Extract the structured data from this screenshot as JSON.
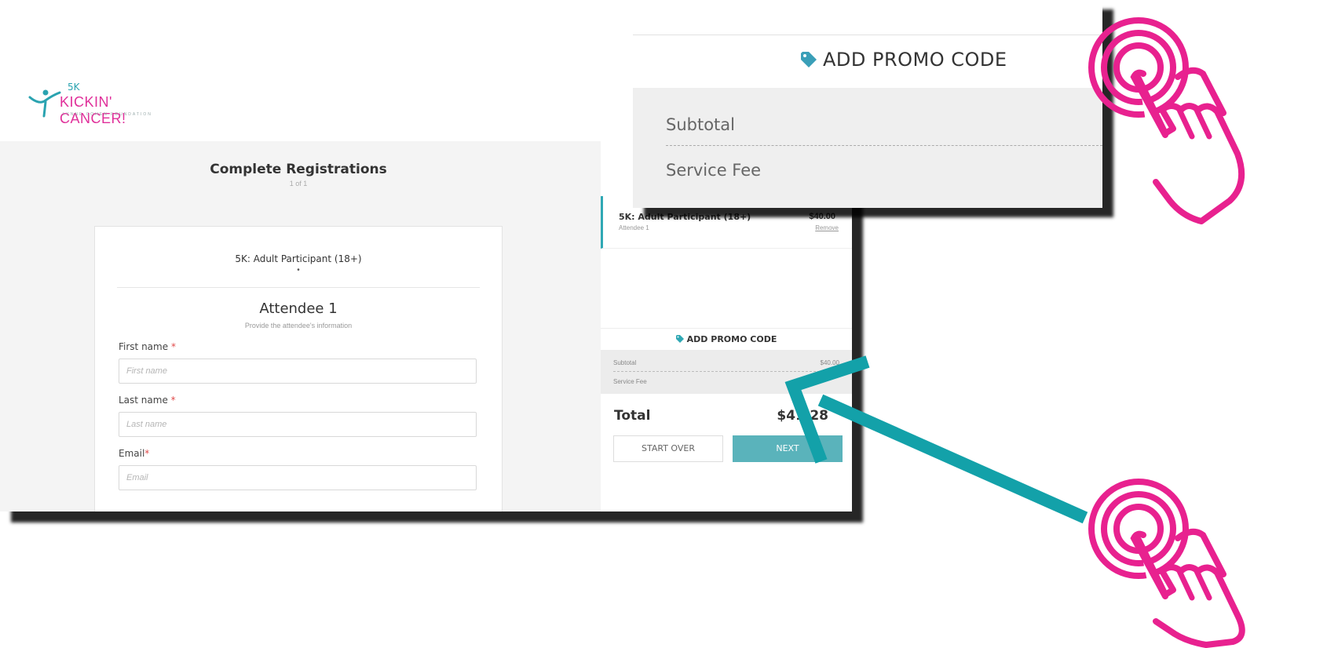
{
  "logo": {
    "five": "5K",
    "brand": "KICKIN' CANCER!",
    "sub": "LYNNE COHEN FOUNDATION"
  },
  "page": {
    "title": "Complete Registrations",
    "subtitle": "1 of 1"
  },
  "form": {
    "ticket_title": "5K: Adult Participant (18+)",
    "ticket_dot": "•",
    "attendee_title": "Attendee 1",
    "attendee_subtitle": "Provide the attendee's information",
    "fields": [
      {
        "label": "First name",
        "required": "*",
        "placeholder": "First name"
      },
      {
        "label": "Last name",
        "required": "*",
        "placeholder": "Last name"
      },
      {
        "label": "Email",
        "required": "*",
        "placeholder": "Email"
      }
    ]
  },
  "summary": {
    "item_title": "5K: Adult Participant (18+)",
    "item_attendee": "Attendee 1",
    "item_price": "$40.00",
    "item_remove": "Remove",
    "promo_label": "ADD PROMO CODE",
    "subtotal_label": "Subtotal",
    "subtotal_amount": "$40.00",
    "service_fee_label": "Service Fee",
    "total_label": "Total",
    "total_amount": "$41.28",
    "start_over_label": "START OVER",
    "next_label": "NEXT"
  },
  "zoom": {
    "promo_label": "ADD PROMO CODE",
    "subtotal_label": "Subtotal",
    "service_fee_label": "Service Fee"
  },
  "colors": {
    "accent_teal": "#2fa8b4",
    "button_teal": "#5ab3bb",
    "annotation_pink": "#e8218f",
    "arrow_teal": "#13a1a9",
    "brand_pink": "#e0309a"
  },
  "icons": [
    "tag-icon",
    "tap-hand-icon",
    "arrow-icon"
  ]
}
